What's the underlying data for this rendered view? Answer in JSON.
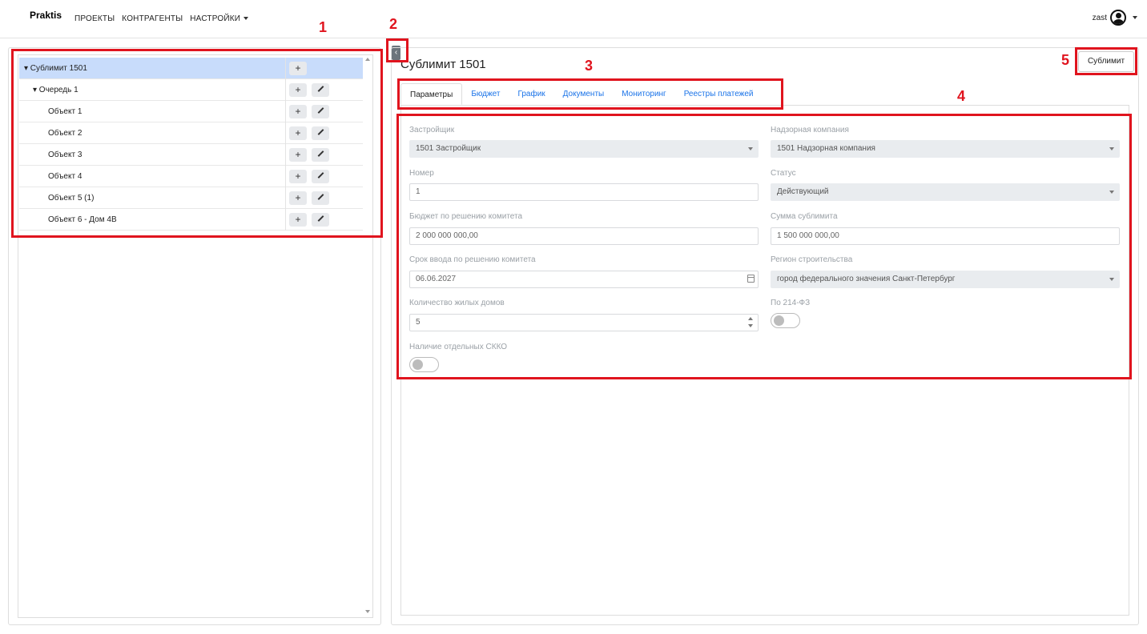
{
  "header": {
    "logo": "Praktis",
    "nav": [
      "ПРОЕКТЫ",
      "КОНТРАГЕНТЫ",
      "НАСТРОЙКИ"
    ],
    "user": "zast"
  },
  "tree": {
    "rows": [
      {
        "label": "▾ Сублимит 1501",
        "selected": true,
        "edit": false
      },
      {
        "label": "▾ Очередь 1",
        "edit": true
      },
      {
        "label": "Объект 1",
        "edit": true
      },
      {
        "label": "Объект 2",
        "edit": true
      },
      {
        "label": "Объект 3",
        "edit": true
      },
      {
        "label": "Объект 4",
        "edit": true
      },
      {
        "label": "Объект 5 (1)",
        "edit": true
      },
      {
        "label": "Объект 6 - Дом 4В",
        "edit": true
      }
    ],
    "plus": "+"
  },
  "collapse": "‹",
  "main": {
    "title": "Сублимит 1501",
    "action_button": "Сублимит",
    "tabs": [
      "Параметры",
      "Бюджет",
      "График",
      "Документы",
      "Мониторинг",
      "Реестры платежей"
    ],
    "form": {
      "developer_label": "Застройщик",
      "developer_value": "1501 Застройщик",
      "supervisor_label": "Надзорная компания",
      "supervisor_value": "1501 Надзорная компания",
      "number_label": "Номер",
      "number_value": "1",
      "status_label": "Статус",
      "status_value": "Действующий",
      "budget_label": "Бюджет по решению комитета",
      "budget_value": "2 000 000 000,00",
      "sum_label": "Сумма сублимита",
      "sum_value": "1 500 000 000,00",
      "deadline_label": "Срок ввода по решению комитета",
      "deadline_value": "06.06.2027",
      "region_label": "Регион строительства",
      "region_value": "город федерального значения Санкт-Петербург",
      "houses_label": "Количество жилых домов",
      "houses_value": "5",
      "law_label": "По 214-ФЗ",
      "skko_label": "Наличие отдельных СККО"
    }
  },
  "annotations": [
    "1",
    "2",
    "3",
    "4",
    "5"
  ],
  "colors": {
    "annotation": "#e0141e",
    "selected_row": "#c8dcfb",
    "tab_link": "#1a73e8"
  }
}
